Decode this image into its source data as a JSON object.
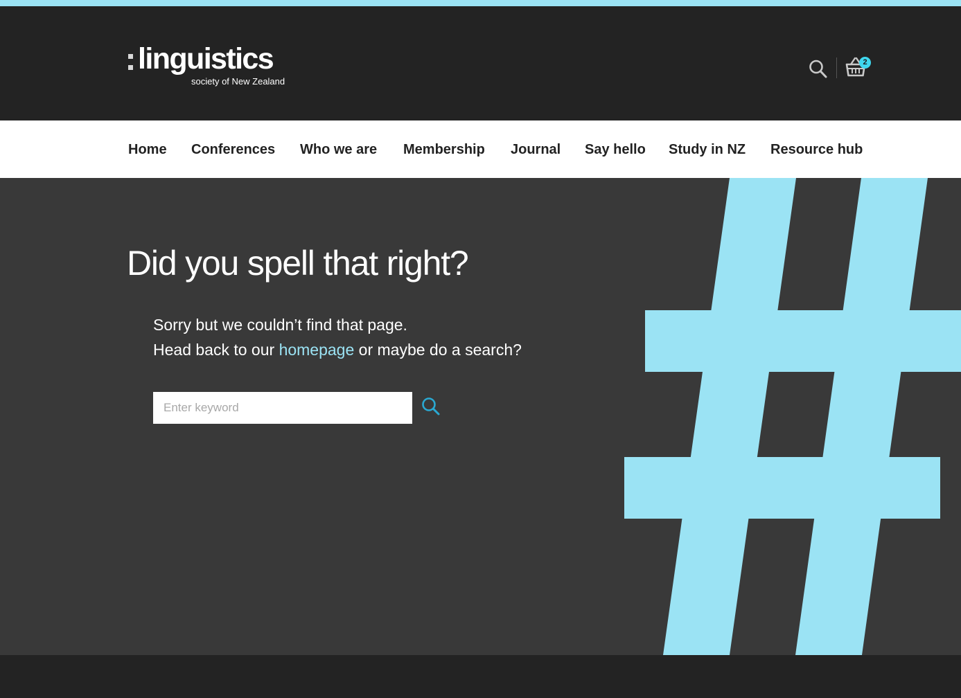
{
  "brand": {
    "name": "linguistics",
    "tagline": "society of New Zealand"
  },
  "header": {
    "search_icon": "search-icon",
    "cart_icon": "basket-icon",
    "cart_count": "2"
  },
  "nav": {
    "items": [
      {
        "label": "Home"
      },
      {
        "label": "Conferences"
      },
      {
        "label": "Who we are"
      },
      {
        "label": "Membership"
      },
      {
        "label": "Journal"
      },
      {
        "label": "Say hello"
      },
      {
        "label": "Study in NZ"
      },
      {
        "label": "Resource hub"
      }
    ]
  },
  "main": {
    "title": "Did you spell that right?",
    "line1": "Sorry but we couldn’t find that page.",
    "line2_before": "Head back to our ",
    "line2_link": "homepage",
    "line2_after": " or maybe do a search?",
    "search": {
      "placeholder": "Enter keyword",
      "value": ""
    },
    "decor_icon": "hash-symbol"
  },
  "colors": {
    "accent": "#9be3f4",
    "badge": "#3fd7ee",
    "header_bg": "#232323",
    "page_bg": "#393939",
    "nav_bg": "#ffffff",
    "search_icon": "#2aa9d2"
  }
}
